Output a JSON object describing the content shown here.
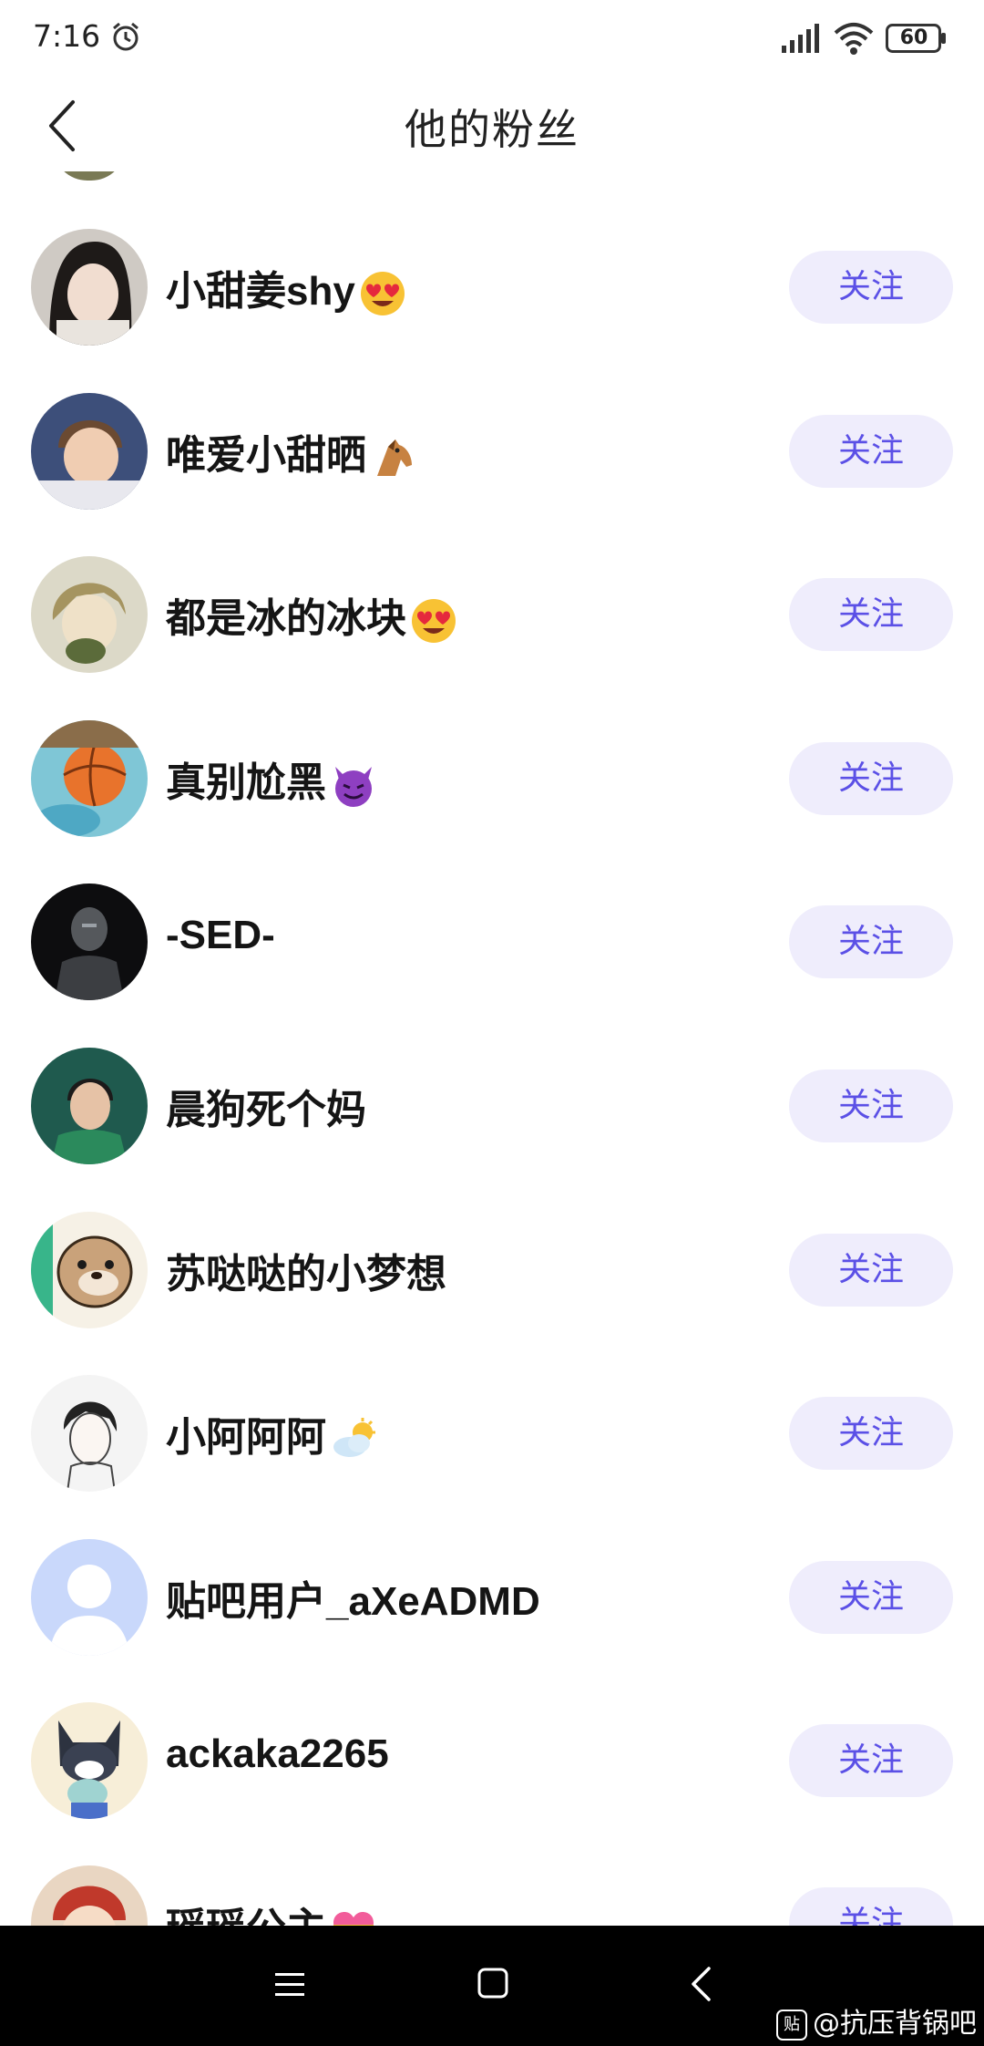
{
  "status_bar": {
    "time": "7:16",
    "battery": "60"
  },
  "header": {
    "title": "他的粉丝"
  },
  "follow_label": "关注",
  "fans": [
    {
      "name": "小甜姜shy",
      "emoji": "heart-eyes"
    },
    {
      "name": "唯爱小甜晒",
      "emoji": "horse"
    },
    {
      "name": "都是冰的冰块",
      "emoji": "heart-eyes"
    },
    {
      "name": "真别尬黑",
      "emoji": "devil"
    },
    {
      "name": "-SED-",
      "emoji": ""
    },
    {
      "name": "晨狗死个妈",
      "emoji": ""
    },
    {
      "name": "苏哒哒的小梦想",
      "emoji": ""
    },
    {
      "name": "小阿阿阿",
      "emoji": "sun-cloud"
    },
    {
      "name": "贴吧用户_aXeADMD",
      "emoji": ""
    },
    {
      "name": "ackaka2265",
      "emoji": ""
    },
    {
      "name": "瑶瑶公主",
      "emoji": "heart"
    }
  ],
  "watermark": {
    "icon": "贴",
    "text": "@抗压背锅吧"
  }
}
